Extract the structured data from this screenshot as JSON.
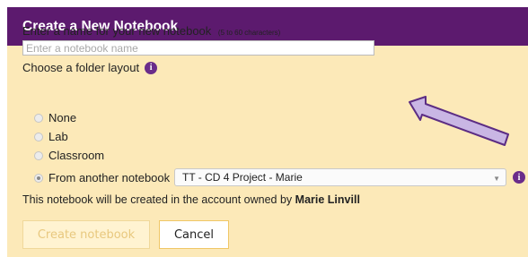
{
  "dialog": {
    "title": "Create a New Notebook",
    "name_prompt": "Enter a name for your new notebook",
    "name_hint": "(5 to 60 characters)",
    "name_placeholder": "Enter a notebook name",
    "name_value": "",
    "layout_prompt": "Choose a folder layout",
    "layout_options": [
      {
        "label": "None",
        "selected": false
      },
      {
        "label": "Lab",
        "selected": false
      },
      {
        "label": "Classroom",
        "selected": false
      },
      {
        "label": "From another notebook",
        "selected": true
      }
    ],
    "source_notebook": "TT - CD 4 Project - Marie",
    "account_text": "This notebook will be created in the account owned by",
    "account_owner": "Marie Linvill",
    "create_button": "Create notebook",
    "cancel_button": "Cancel"
  },
  "icons": {
    "info": "info-icon",
    "caret": "chevron-down-icon",
    "annotation": "arrow-annotation"
  },
  "colors": {
    "titlebar": "#5c1a6e",
    "panel": "#fce9b8",
    "info_icon": "#6a2c8a",
    "arrow_fill": "#c9b6e4",
    "arrow_stroke": "#5c2d84"
  }
}
